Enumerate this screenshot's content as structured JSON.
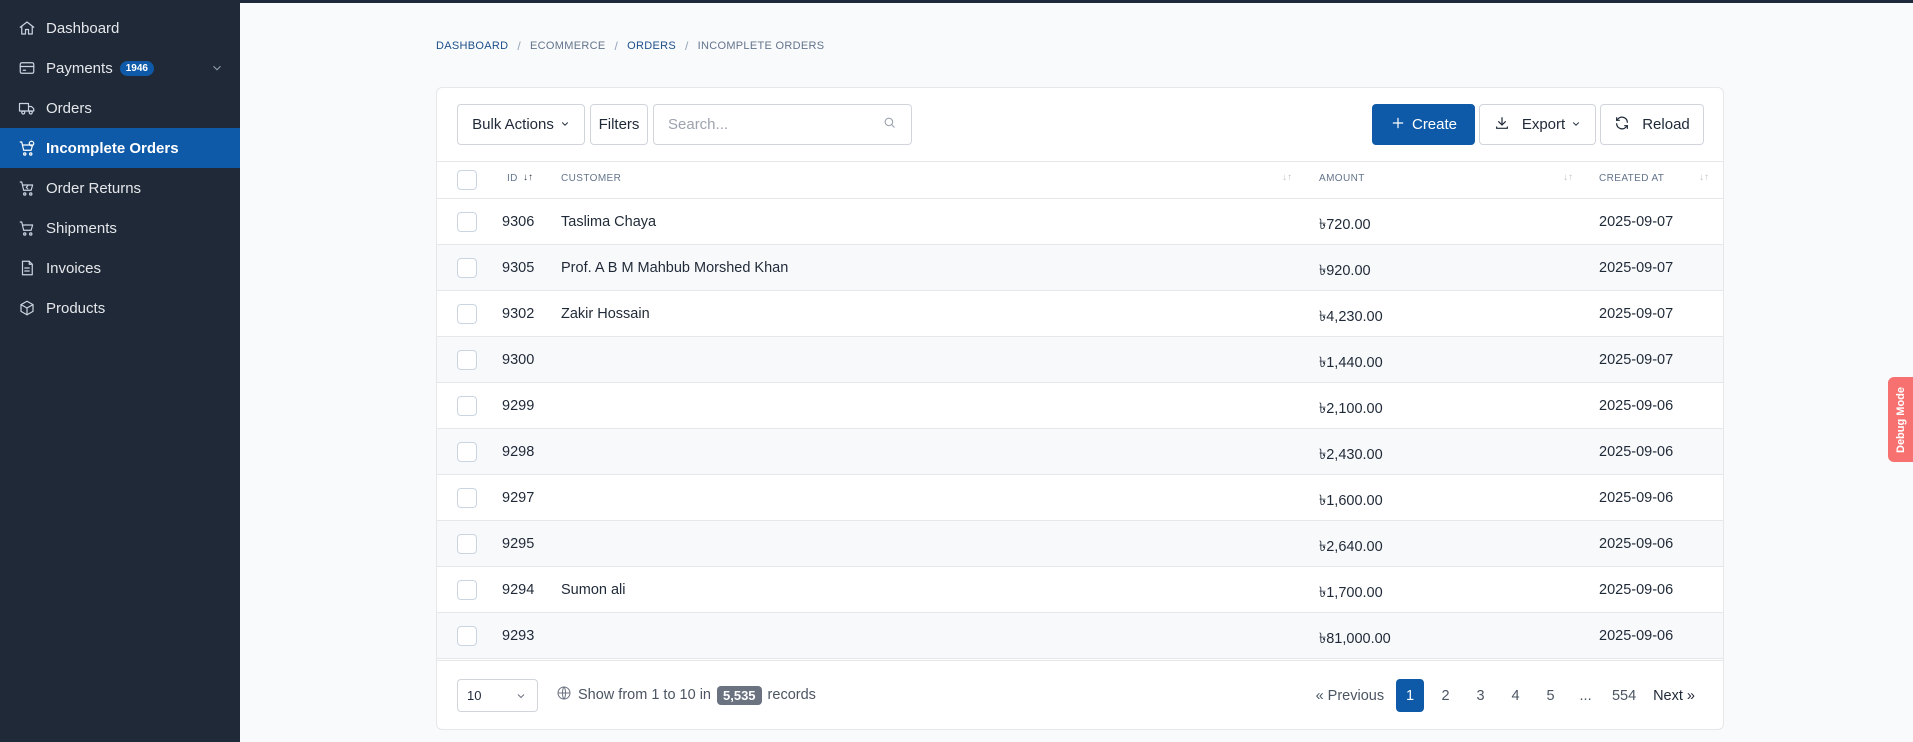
{
  "sidebar": {
    "items": [
      {
        "label": "Dashboard",
        "icon": "home-icon"
      },
      {
        "label": "Payments",
        "icon": "credit-card-icon",
        "badge": "1946"
      },
      {
        "label": "Orders",
        "icon": "truck-icon"
      },
      {
        "label": "Incomplete Orders",
        "icon": "cart-alert-icon",
        "active": true
      },
      {
        "label": "Order Returns",
        "icon": "cart-return-icon"
      },
      {
        "label": "Shipments",
        "icon": "cart-icon"
      },
      {
        "label": "Invoices",
        "icon": "invoice-icon"
      },
      {
        "label": "Products",
        "icon": "package-icon"
      }
    ]
  },
  "breadcrumb": [
    "Dashboard",
    "Ecommerce",
    "Orders",
    "Incomplete Orders"
  ],
  "toolbar": {
    "bulk_actions": "Bulk Actions",
    "filters": "Filters",
    "search_placeholder": "Search...",
    "create": "Create",
    "export": "Export",
    "reload": "Reload"
  },
  "table": {
    "columns": [
      "ID",
      "Customer",
      "Amount",
      "Created At"
    ],
    "rows": [
      {
        "id": "9306",
        "customer": "Taslima Chaya",
        "amount": "৳720.00",
        "created_at": "2025-09-07"
      },
      {
        "id": "9305",
        "customer": "Prof. A B M Mahbub Morshed Khan",
        "amount": "৳920.00",
        "created_at": "2025-09-07"
      },
      {
        "id": "9302",
        "customer": "Zakir Hossain",
        "amount": "৳4,230.00",
        "created_at": "2025-09-07"
      },
      {
        "id": "9300",
        "customer": "",
        "amount": "৳1,440.00",
        "created_at": "2025-09-07"
      },
      {
        "id": "9299",
        "customer": "",
        "amount": "৳2,100.00",
        "created_at": "2025-09-06"
      },
      {
        "id": "9298",
        "customer": "",
        "amount": "৳2,430.00",
        "created_at": "2025-09-06"
      },
      {
        "id": "9297",
        "customer": "",
        "amount": "৳1,600.00",
        "created_at": "2025-09-06"
      },
      {
        "id": "9295",
        "customer": "",
        "amount": "৳2,640.00",
        "created_at": "2025-09-06"
      },
      {
        "id": "9294",
        "customer": "Sumon ali",
        "amount": "৳1,700.00",
        "created_at": "2025-09-06"
      },
      {
        "id": "9293",
        "customer": "",
        "amount": "৳81,000.00",
        "created_at": "2025-09-06"
      }
    ]
  },
  "footer": {
    "per_page": "10",
    "info_prefix": "Show from 1 to 10 in",
    "total": "5,535",
    "info_suffix": "records",
    "pager": {
      "previous": "« Previous",
      "pages": [
        "1",
        "2",
        "3",
        "4",
        "5"
      ],
      "ellipsis": "...",
      "last": "554",
      "next": "Next »",
      "current": "1"
    }
  },
  "debug": "Debug Mode",
  "colors": {
    "sidebar_bg": "#1f2937",
    "accent": "#0f5aa8",
    "debug": "#f87171"
  }
}
